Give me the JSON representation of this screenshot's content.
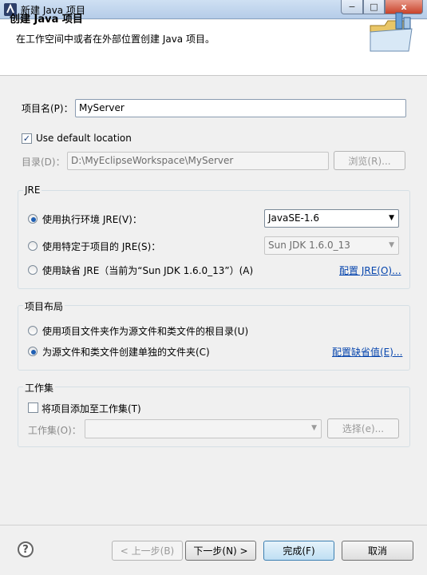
{
  "window": {
    "title": "新建 Java 项目",
    "close_glyph": "x",
    "min_glyph": "−",
    "max_glyph": "□"
  },
  "header": {
    "title": "创建 Java 项目",
    "description": "在工作空间中或者在外部位置创建 Java 项目。"
  },
  "project": {
    "name_label": "项目名(P)：",
    "name_value": "MyServer"
  },
  "location": {
    "use_default_label": "Use default location",
    "use_default_checked": true,
    "dir_label": "目录(D)：",
    "dir_value": "D:\\MyEclipseWorkspace\\MyServer",
    "browse_label": "浏览(R)..."
  },
  "jre": {
    "group_title": "JRE",
    "opt_env_label": "使用执行环境 JRE(V)：",
    "opt_env_value": "JavaSE-1.6",
    "opt_specific_label": "使用特定于项目的 JRE(S)：",
    "opt_specific_value": "Sun JDK 1.6.0_13",
    "opt_default_label": "使用缺省 JRE（当前为“Sun JDK 1.6.0_13”）(A)",
    "configure_link": "配置 JRE(O)...",
    "selected": "env"
  },
  "layout": {
    "group_title": "项目布局",
    "opt_root_label": "使用项目文件夹作为源文件和类文件的根目录(U)",
    "opt_separate_label": "为源文件和类文件创建单独的文件夹(C)",
    "configure_link": "配置缺省值(E)...",
    "selected": "separate"
  },
  "working_set": {
    "group_title": "工作集",
    "add_label": "将项目添加至工作集(T)",
    "add_checked": false,
    "set_label": "工作集(O)：",
    "set_value": "",
    "select_label": "选择(e)..."
  },
  "buttons": {
    "back": "< 上一步(B)",
    "next": "下一步(N) >",
    "finish": "完成(F)",
    "cancel": "取消"
  },
  "help_glyph": "?",
  "dropdown_glyph": "▼",
  "check_glyph": "✓"
}
